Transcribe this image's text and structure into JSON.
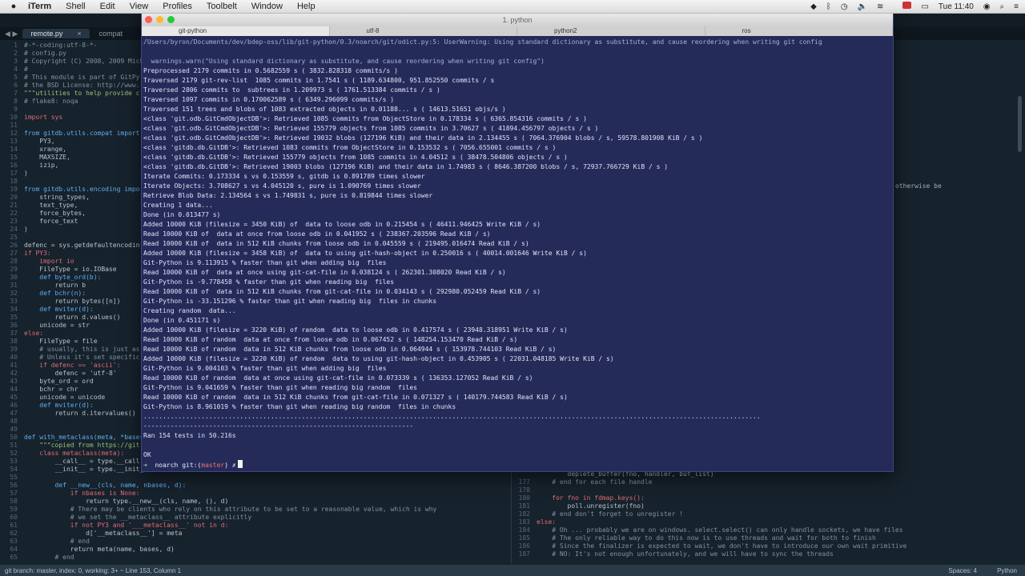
{
  "menubar": {
    "app": "iTerm",
    "items": [
      "Shell",
      "Edit",
      "View",
      "Profiles",
      "Toolbelt",
      "Window",
      "Help"
    ],
    "clock": "Tue 11:40"
  },
  "editor": {
    "tabs": [
      {
        "label": "remote.py",
        "close": "×",
        "active": true
      },
      {
        "label": "compat",
        "active": false
      }
    ],
    "code_lines": [
      {
        "n": "1",
        "t": "#-*-coding:utf-8-*-",
        "c": "cm"
      },
      {
        "n": "2",
        "t": "# config.py",
        "c": "cm"
      },
      {
        "n": "3",
        "t": "# Copyright (C) 2008, 2009 Mich",
        "c": "cm"
      },
      {
        "n": "4",
        "t": "#",
        "c": "cm"
      },
      {
        "n": "5",
        "t": "# This module is part of GitPy",
        "c": "cm"
      },
      {
        "n": "6",
        "t": "# the BSD License: http://www.",
        "c": "cm"
      },
      {
        "n": "7",
        "t": "\"\"\"utilities to help provide c",
        "c": "st"
      },
      {
        "n": "8",
        "t": "# flake8: noqa",
        "c": "cm"
      },
      {
        "n": "9",
        "t": "",
        "c": "ct"
      },
      {
        "n": "10",
        "t": "import sys",
        "c": "kw"
      },
      {
        "n": "11",
        "t": "",
        "c": "ct"
      },
      {
        "n": "12",
        "t": "from gitdb.utils.compat import",
        "c": "fn"
      },
      {
        "n": "13",
        "t": "    PY3,",
        "c": "ct"
      },
      {
        "n": "14",
        "t": "    xrange,",
        "c": "ct"
      },
      {
        "n": "15",
        "t": "    MAXSIZE,",
        "c": "ct"
      },
      {
        "n": "16",
        "t": "    izip,",
        "c": "ct"
      },
      {
        "n": "17",
        "t": ")",
        "c": "ct"
      },
      {
        "n": "18",
        "t": "",
        "c": "ct"
      },
      {
        "n": "19",
        "t": "from gitdb.utils.encoding impo",
        "c": "fn"
      },
      {
        "n": "20",
        "t": "    string_types,",
        "c": "ct"
      },
      {
        "n": "21",
        "t": "    text_type,",
        "c": "ct"
      },
      {
        "n": "22",
        "t": "    force_bytes,",
        "c": "ct"
      },
      {
        "n": "23",
        "t": "    force_text",
        "c": "ct"
      },
      {
        "n": "24",
        "t": ")",
        "c": "ct"
      },
      {
        "n": "25",
        "t": "",
        "c": "ct"
      },
      {
        "n": "26",
        "t": "defenc = sys.getdefaultencodin",
        "c": "ct"
      },
      {
        "n": "27",
        "t": "if PY3:",
        "c": "kw"
      },
      {
        "n": "28",
        "t": "    import io",
        "c": "kw"
      },
      {
        "n": "29",
        "t": "    FileType = io.IOBase",
        "c": "ct"
      },
      {
        "n": "30",
        "t": "    def byte_ord(b):",
        "c": "fn"
      },
      {
        "n": "31",
        "t": "        return b",
        "c": "ct"
      },
      {
        "n": "32",
        "t": "    def bchr(n):",
        "c": "fn"
      },
      {
        "n": "33",
        "t": "        return bytes([n])",
        "c": "ct"
      },
      {
        "n": "34",
        "t": "    def mviter(d):",
        "c": "fn"
      },
      {
        "n": "35",
        "t": "        return d.values()",
        "c": "ct"
      },
      {
        "n": "36",
        "t": "    unicode = str",
        "c": "ct"
      },
      {
        "n": "37",
        "t": "else:",
        "c": "kw"
      },
      {
        "n": "38",
        "t": "    FileType = file",
        "c": "ct"
      },
      {
        "n": "39",
        "t": "    # usually, this is just as",
        "c": "cm"
      },
      {
        "n": "40",
        "t": "    # Unless it's set specific",
        "c": "cm"
      },
      {
        "n": "41",
        "t": "    if defenc == 'ascii':",
        "c": "kw"
      },
      {
        "n": "42",
        "t": "        defenc = 'utf-8'",
        "c": "ct"
      },
      {
        "n": "43",
        "t": "    byte_ord = ord",
        "c": "ct"
      },
      {
        "n": "44",
        "t": "    bchr = chr",
        "c": "ct"
      },
      {
        "n": "45",
        "t": "    unicode = unicode",
        "c": "ct"
      },
      {
        "n": "46",
        "t": "    def mviter(d):",
        "c": "fn"
      },
      {
        "n": "47",
        "t": "        return d.itervalues()",
        "c": "ct"
      },
      {
        "n": "48",
        "t": "",
        "c": "ct"
      },
      {
        "n": "49",
        "t": "",
        "c": "ct"
      },
      {
        "n": "50",
        "t": "def with_metaclass(meta, *bases",
        "c": "fn"
      },
      {
        "n": "51",
        "t": "    \"\"\"copied from https://git",
        "c": "st"
      },
      {
        "n": "52",
        "t": "    class metaclass(meta):",
        "c": "kw"
      },
      {
        "n": "53",
        "t": "        __call__ = type.__call",
        "c": "ct"
      },
      {
        "n": "54",
        "t": "        __init__ = type.__init_",
        "c": "ct"
      },
      {
        "n": "55",
        "t": "",
        "c": "ct"
      },
      {
        "n": "56",
        "t": "        def __new__(cls, name, nbases, d):",
        "c": "fn"
      },
      {
        "n": "57",
        "t": "            if nbases is None:",
        "c": "kw"
      },
      {
        "n": "58",
        "t": "                return type.__new__(cls, name, (), d)",
        "c": "ct"
      },
      {
        "n": "59",
        "t": "            # There may be clients who rely on this attribute to be set to a reasonable value, which is why",
        "c": "cm"
      },
      {
        "n": "60",
        "t": "            # we set the __metaclass__ attribute explicitly",
        "c": "cm"
      },
      {
        "n": "61",
        "t": "            if not PY3 and '___metaclass__' not in d:",
        "c": "kw"
      },
      {
        "n": "62",
        "t": "                d['__metaclass__'] = meta",
        "c": "ct"
      },
      {
        "n": "63",
        "t": "            # end",
        "c": "cm"
      },
      {
        "n": "64",
        "t": "            return meta(name, bases, d)",
        "c": "ct"
      },
      {
        "n": "65",
        "t": "        # end",
        "c": "cm"
      }
    ],
    "right_code_lines": [
      {
        "n": "",
        "t": "        deplete_buffer(fno, handler, buf_list)",
        "c": "ct"
      },
      {
        "n": "177",
        "t": "    # end for each file handle",
        "c": "cm"
      },
      {
        "n": "178",
        "t": "",
        "c": "ct"
      },
      {
        "n": "180",
        "t": "    for fno in fdmap.keys():",
        "c": "kw"
      },
      {
        "n": "181",
        "t": "        poll.unregister(fno)",
        "c": "ct"
      },
      {
        "n": "182",
        "t": "    # end don't forget to unregister !",
        "c": "cm"
      },
      {
        "n": "183",
        "t": "else:",
        "c": "kw"
      },
      {
        "n": "184",
        "t": "    # Oh ... probably we are on windows. select.select() can only handle sockets, we have files",
        "c": "cm"
      },
      {
        "n": "185",
        "t": "    # The only reliable way to do this now is to use threads and wait for both to finish",
        "cm": "cm",
        "c": "cm"
      },
      {
        "n": "186",
        "t": "    # Since the finalizer is expected to wait, we don't have to introduce our own wait primitive",
        "c": "cm"
      },
      {
        "n": "187",
        "t": "    # NO: It's not enough unfortunately, and we will have to sync the threads",
        "c": "cm"
      }
    ],
    "right_pane_snippet": "otherwise be",
    "status_left": "git branch: master, index: 0, working: 3+ ~  Line 153, Column 1",
    "status_spaces": "Spaces: 4",
    "status_lang": "Python"
  },
  "terminal": {
    "title": "1. python",
    "tabs": [
      "git-python",
      "utf-8",
      "python2",
      "ros"
    ],
    "lines": [
      "/Users/byron/Documents/dev/bdep-oss/lib/git-python/0.3/noarch/git/odict.py:5: UserWarning: Using standard dictionary as substitute, and cause reordering when writing git config",
      "",
      "  warnings.warn(\"Using standard dictionary as substitute, and cause reordering when writing git config\")",
      "Preprocessed 2179 commits in 0.5682559 s ( 3832.828318 commits/s )",
      "Traversed 2179 git-rev-list  1085 commits in 1.7541 s ( 1189.634800, 951.852550 commits / s",
      "Traversed 2806 commits to  subtrees in 1.209973 s ( 1761.513384 commits / s )",
      "Traversed 1097 commits in 0.170062589 s ( 6349.296099 commits/s )",
      "Traversed 151 trees and blobs of 1083 extracted objects in 0.01188... s ( 14613.51651 objs/s )",
      "<class 'git.odb.GitCmdObjectDB'>: Retrieved 1085 commits from ObjectStore in 0.178334 s ( 6365.854316 commits / s )",
      "<class 'git.odb.GitCmdObjectDB'>: Retrieved 155779 objects from 1085 commits in 3.70627 s ( 41894.456797 objects / s )",
      "<class 'git.odb.GitCmdObjectDB'>: Retrieved 19032 blobs (127196 KiB) and their data in 2.134455 s ( 7064.376904 blobs / s, 59578.801908 KiB / s )",
      "<class 'gitdb.db.GitDB'>: Retrieved 1083 commits from ObjectStore in 0.153532 s ( 7056.655001 commits / s )",
      "<class 'gitdb.db.GitDB'>: Retrieved 155779 objects from 1085 commits in 4.04512 s ( 38478.504806 objects / s )",
      "<class 'gitdb.db.GitDB'>: Retrieved 19003 blobs (127196 KiB) and their data in 1.74983 s ( 8646.387200 blobs / s, 72937.766729 KiB / s )",
      "Iterate Commits: 0.173334 s vs 0.153559 s, gitdb is 0.891789 times slower",
      "Iterate Objects: 3.708627 s vs 4.045120 s, pure is 1.090769 times slower",
      "Retrieve Blob Data: 2.134564 s vs 1.749831 s, pure is 0.819844 times slower",
      "Creating 1 data...",
      "Done (in 0.013477 s)",
      "Added 10000 KiB (filesize = 3450 KiB) of  data to loose odb in 0.215454 s ( 46411.946425 Write KiB / s)",
      "Read 10000 KiB of  data at once from loose odb in 0.041952 s ( 238367.203596 Read KiB / s)",
      "Read 10000 KiB of  data in 512 KiB chunks from loose odb in 0.045559 s ( 219495.016474 Read KiB / s)",
      "Added 10000 KiB (filesize = 3458 KiB) of  data to using git-hash-object in 0.250016 s ( 40014.001646 Write KiB / s)",
      "Git-Python is 9.113915 % faster than git when adding big  files",
      "Read 10000 KiB of  data at once using git-cat-file in 0.038124 s ( 262301.308020 Read KiB / s)",
      "Git-Python is -9.778458 % faster than git when reading big  files",
      "Read 10000 KiB of  data in 512 KiB chunks from git-cat-file in 0.034143 s ( 292980.052459 Read KiB / s)",
      "Git-Python is -33.151296 % faster than git when reading big  files in chunks",
      "Creating random  data...",
      "Done (in 0.451171 s)",
      "Added 10000 KiB (filesize = 3220 KiB) of random  data to loose odb in 0.417574 s ( 23948.318951 Write KiB / s)",
      "Read 10000 KiB of random  data at once from loose odb in 0.067452 s ( 148254.153470 Read KiB / s)",
      "Read 10000 KiB of random  data in 512 KiB chunks from loose odb in 0.064944 s ( 153978.744103 Read KiB / s)",
      "Added 10000 KiB (filesize = 3220 KiB) of random  data to using git-hash-object in 0.453905 s ( 22031.048185 Write KiB / s)",
      "Git-Python is 9.004103 % faster than git when adding big  files",
      "Read 10000 KiB of random  data at once using git-cat-file in 0.073339 s ( 136353.127052 Read KiB / s)",
      "Git-Python is 9.041659 % faster than git when reading big random  files",
      "Read 10000 KiB of random  data in 512 KiB chunks from git-cat-file in 0.071327 s ( 140179.744583 Read KiB / s)",
      "Git-Python is 8.961019 % faster than git when reading big random  files in chunks",
      "................................................................................................................................................................",
      "----------------------------------------------------------------------",
      "Ran 154 tests in 50.216s",
      "",
      "OK"
    ],
    "prompt_dir": "noarch",
    "prompt_git": "git:(",
    "prompt_branch": "master",
    "prompt_end": ") ✗"
  },
  "colors": {
    "terminal_bg": "#262c5c",
    "editor_bg": "#16222c",
    "branch": "#f0736c",
    "prompt_arrow": "#8fd6a0"
  }
}
